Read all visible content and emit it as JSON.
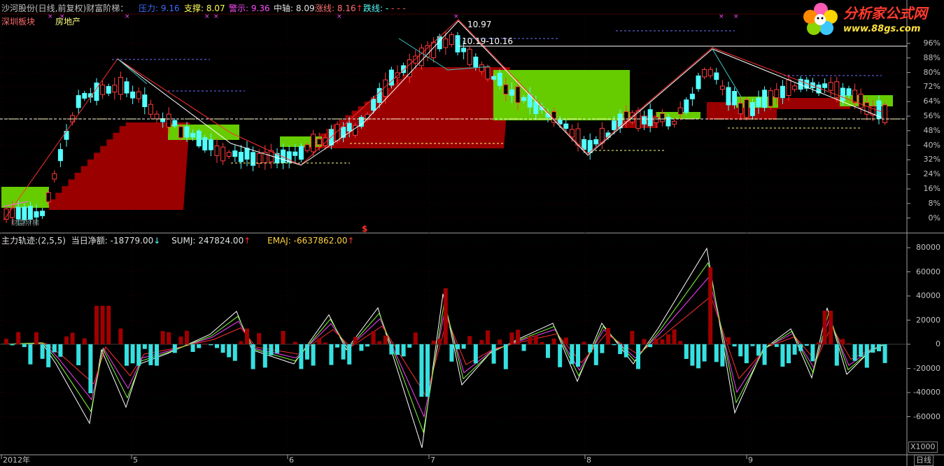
{
  "header": {
    "stock": "沙河股份(日线,前复权)",
    "indicator": "财富阶梯：",
    "pressure_label": "压力:",
    "pressure_value": "9.16",
    "support_label": "支撑:",
    "support_value": "8.07",
    "warn_label": "警示:",
    "warn_value": "9.36",
    "center_label": "中轴:",
    "center_value": "8.09",
    "rise_label": "涨线:",
    "rise_value": "8.16",
    "fall_label": "跌线:",
    "fall_value": "-",
    "sector1": "深圳板块",
    "sector2": "房地产",
    "sub_caption": "财富阶梯"
  },
  "price_annotations": {
    "high": "10.97",
    "range": "10.19-10.16",
    "low_flag": "$"
  },
  "price_axis": [
    "96%",
    "88%",
    "80%",
    "72%",
    "64%",
    "56%",
    "48%",
    "40%",
    "32%",
    "24%",
    "16%",
    "8%",
    "0%"
  ],
  "lower": {
    "title": "主力轨迹:(2,5,5)",
    "net_label": "当日净额:",
    "net_value": "-18779.00",
    "sumj_label": "SUMJ:",
    "sumj_value": "247824.00",
    "emaj_label": "EMAJ:",
    "emaj_value": "-6637862.00"
  },
  "lower_axis": [
    "80000",
    "60000",
    "40000",
    "20000",
    "0",
    "-20000",
    "-40000",
    "-60000"
  ],
  "scale_button": "X1000",
  "time_axis": [
    "2012年",
    "5",
    "6",
    "7",
    "8",
    "9"
  ],
  "period_button": "日线",
  "logo": {
    "name": "分析家公式网",
    "url": "www.88gs.com"
  },
  "colors": {
    "up": "#ff3c3c",
    "down": "#54ffff",
    "pressure_zone": "#66cc00",
    "support_zone": "#9a0000",
    "white_line": "#ffffff"
  }
}
